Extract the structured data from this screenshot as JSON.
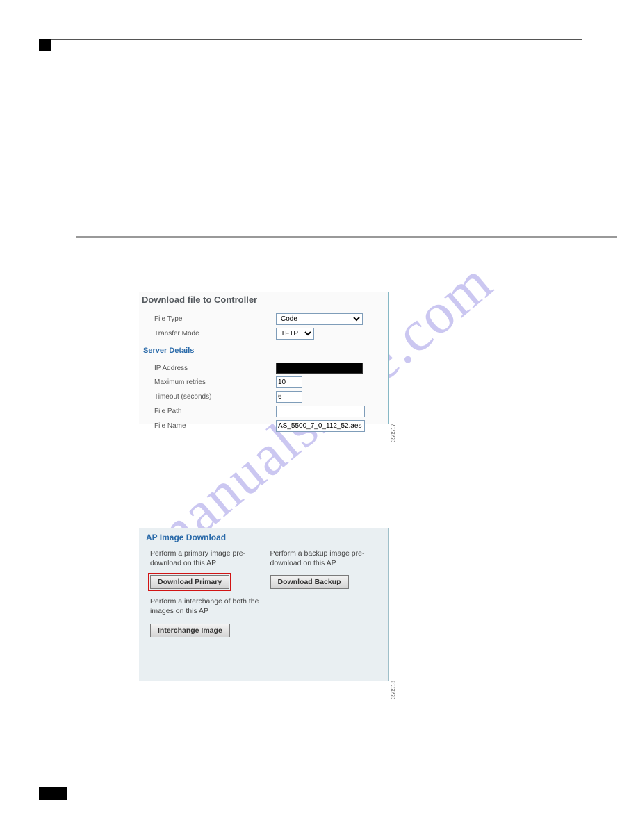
{
  "watermark": "manualshive.com",
  "shot1": {
    "title": "Download file to Controller",
    "fileTypeLabel": "File Type",
    "fileTypeValue": "Code",
    "transferModeLabel": "Transfer Mode",
    "transferModeValue": "TFTP",
    "serverDetails": "Server Details",
    "ipLabel": "IP Address",
    "maxRetriesLabel": "Maximum retries",
    "maxRetriesValue": "10",
    "timeoutLabel": "Timeout (seconds)",
    "timeoutValue": "6",
    "filePathLabel": "File Path",
    "filePathValue": "",
    "fileNameLabel": "File Name",
    "fileNameValue": "AS_5500_7_0_112_52.aes",
    "imgId": "350517"
  },
  "shot2": {
    "title": "AP Image Download",
    "primaryDesc": "Perform a primary image pre-download on this AP",
    "primaryBtn": "Download Primary",
    "backupDesc": "Perform a backup image pre-download on this AP",
    "backupBtn": "Download Backup",
    "interchangeDesc": "Perform a interchange of both the images on this AP",
    "interchangeBtn": "Interchange Image",
    "imgId": "350518"
  }
}
